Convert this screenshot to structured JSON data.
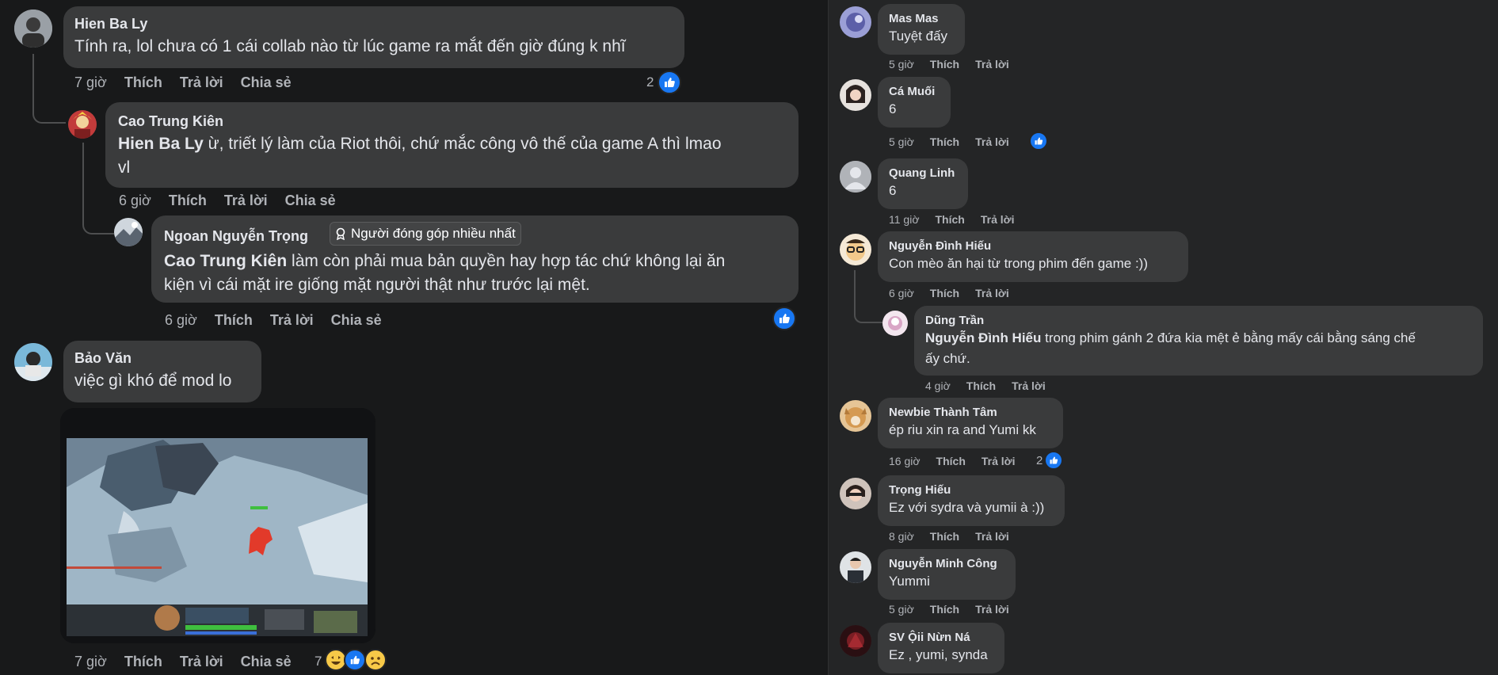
{
  "left": {
    "comments": [
      {
        "author": "Hien Ba Ly",
        "text": "Tính ra, lol chưa có 1 cái collab nào từ lúc game ra mắt đến giờ đúng k nhĩ",
        "time": "7 giờ",
        "like": "Thích",
        "reply": "Trả lời",
        "share": "Chia sẻ",
        "reactions": "2"
      },
      {
        "author": "Cao Trung Kiên",
        "mention": "Hien Ba Ly",
        "text_line1": " ừ, triết lý làm của Riot thôi, chứ mắc công vô thế của game A thì lmao",
        "text_line2": "vl",
        "time": "6 giờ",
        "like": "Thích",
        "reply": "Trả lời",
        "share": "Chia sẻ"
      },
      {
        "author": "Ngoan Nguyễn Trọng",
        "badge": "Người đóng góp nhiều nhất",
        "mention": "Cao Trung Kiên",
        "text_line1": " làm còn phải mua bản quyền hay hợp tác chứ không lại ăn",
        "text_line2": "kiện vì cái mặt ire giống mặt người thật như trước lại mệt.",
        "time": "6 giờ",
        "like": "Thích",
        "reply": "Trả lời",
        "share": "Chia sẻ"
      },
      {
        "author": "Bảo Văn",
        "text": "việc gì khó để mod lo",
        "time": "7 giờ",
        "like": "Thích",
        "reply": "Trả lời",
        "share": "Chia sẻ",
        "reactions": "7"
      }
    ]
  },
  "right": {
    "comments": [
      {
        "author": "Mas Mas",
        "text": "Tuyệt đấy",
        "time": "5 giờ",
        "like": "Thích",
        "reply": "Trả lời"
      },
      {
        "author": "Cá Muối",
        "text": "6",
        "time": "5 giờ",
        "like": "Thích",
        "reply": "Trả lời"
      },
      {
        "author": "Quang Linh",
        "text": "6",
        "time": "11 giờ",
        "like": "Thích",
        "reply": "Trả lời"
      },
      {
        "author": "Nguyễn Đình Hiếu",
        "text": "Con mèo ăn hại từ trong phim đến game :))",
        "time": "6 giờ",
        "like": "Thích",
        "reply": "Trả lời"
      },
      {
        "author": "Dũng Trần",
        "mention": "Nguyễn Đình Hiếu",
        "text_line1": " trong phim gánh 2 đứa kia mệt ẻ bằng mấy cái bằng sáng chế",
        "text_line2": "ấy chứ.",
        "time": "4 giờ",
        "like": "Thích",
        "reply": "Trả lời"
      },
      {
        "author": "Newbie Thành Tâm",
        "text": "ép riu xin ra and Yumi kk",
        "time": "16 giờ",
        "like": "Thích",
        "reply": "Trả lời",
        "reactions": "2"
      },
      {
        "author": "Trọng Hiếu",
        "text": "Ez với sydra và yumii à :))",
        "time": "8 giờ",
        "like": "Thích",
        "reply": "Trả lời"
      },
      {
        "author": "Nguyễn Minh Công",
        "text": "Yummi",
        "time": "5 giờ",
        "like": "Thích",
        "reply": "Trả lời"
      },
      {
        "author": "SV Ộii Nừn Ná",
        "text": "Ez , yumi, synda",
        "time": "",
        "like": "",
        "reply": ""
      }
    ]
  },
  "icons": {
    "like": "thumbs-up-icon",
    "haha": "haha-emoji-icon",
    "sad": "sad-emoji-icon",
    "badge": "contributor-badge-icon"
  },
  "colors": {
    "page_bg": "#18191a",
    "panel_bg": "#242526",
    "bubble_bg": "#3a3b3c",
    "text": "#e4e6eb",
    "muted": "#b0b3b8",
    "like_blue": "#1877f2"
  }
}
